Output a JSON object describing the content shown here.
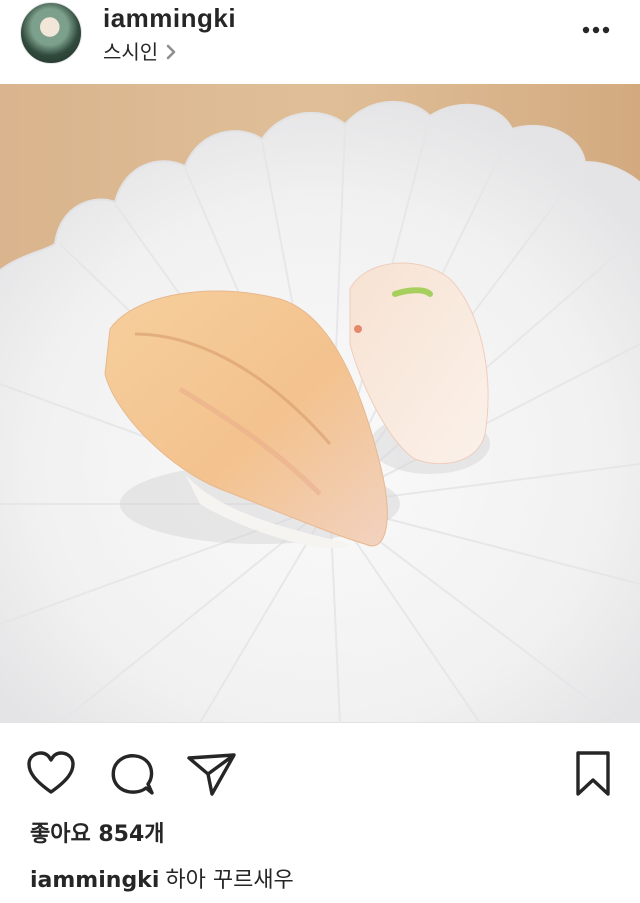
{
  "post": {
    "username": "iammingki",
    "location": "스시인",
    "likes_text": "좋아요 854개",
    "caption_user": "iammingki",
    "caption_text": "하아 꾸르새우"
  },
  "icons": {
    "avatar": "profile-avatar",
    "more": "more-options-icon",
    "location_chevron": "chevron-right-icon",
    "like": "heart-icon",
    "comment": "comment-bubble-icon",
    "share": "paper-plane-icon",
    "save": "bookmark-icon"
  },
  "colors": {
    "text": "#262626",
    "background": "#ffffff",
    "wood": "#d8b48c",
    "plate": "#f4f4f4"
  }
}
